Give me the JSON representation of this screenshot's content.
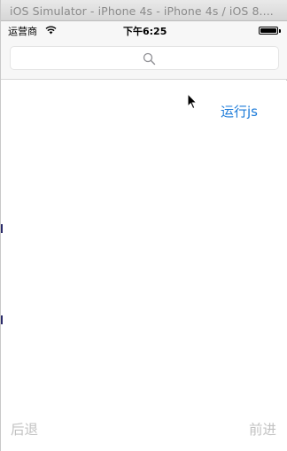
{
  "window": {
    "title": "iOS Simulator - iPhone 4s - iPhone 4s / iOS 8...."
  },
  "statusbar": {
    "carrier": "运营商",
    "time": "下午6:25",
    "wifi_icon": "wifi-icon",
    "battery_icon": "battery-icon"
  },
  "navbar": {
    "search_icon": "search-icon"
  },
  "content": {
    "run_js_label": "运行js"
  },
  "toolbar": {
    "back_label": "后退",
    "forward_label": "前进"
  },
  "colors": {
    "accent": "#1a7ad9",
    "disabled_text": "#c2c2c2",
    "bar_background": "#f7f7f7"
  }
}
